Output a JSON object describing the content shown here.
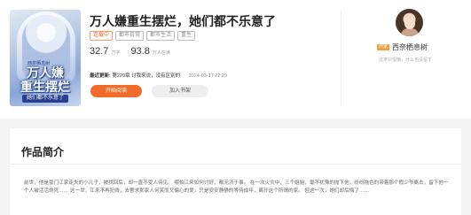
{
  "book": {
    "title": "万人嫌重生摆烂，她们都不乐意了",
    "cover": {
      "line1": "万人嫌",
      "line2": "重生摆烂",
      "subtitle": "她们都不乐意了",
      "small": "西奈栖息树"
    },
    "tags": [
      "连载中",
      "都市日常",
      "都市生活",
      "重生"
    ],
    "stats": [
      {
        "value": "32.7",
        "unit": "万字"
      },
      {
        "value": "93.8",
        "unit": "万人在读"
      }
    ],
    "update": {
      "label": "最近更新:",
      "chapter": "第220章 讨我来说，没有区别的",
      "time": "2024-03-17 22:29"
    },
    "buttons": {
      "read": "开始阅读",
      "shelf": "加入书架"
    }
  },
  "author": {
    "badge": "作家",
    "name": "西奈栖息树",
    "info": "这家伙很懒，什么也没留下"
  },
  "intro": {
    "heading": "作品简介",
    "text": "前世，他是豪门江家走失的小儿子，被找回后，却一直不受人待见。   哪怕江来如何讨好，都无济于事。   在一次火灾中，三个姐姐，毫不犹豫的抛下他，纷纷拖色的带着那个假少爷离去，留下他一个人被活活烧死……   这一世，江来不再犯贱，去奢求那家人何笑而又偏心的爱，只是安安静静的等待成年，离开这个所谓的家。   但这一次，她们却后悔了……"
  }
}
